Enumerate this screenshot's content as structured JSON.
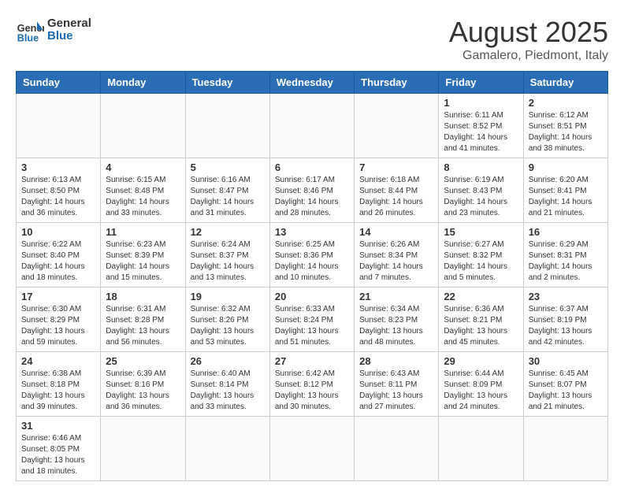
{
  "logo": {
    "text_general": "General",
    "text_blue": "Blue"
  },
  "title": "August 2025",
  "subtitle": "Gamalero, Piedmont, Italy",
  "weekdays": [
    "Sunday",
    "Monday",
    "Tuesday",
    "Wednesday",
    "Thursday",
    "Friday",
    "Saturday"
  ],
  "weeks": [
    [
      {
        "day": "",
        "info": ""
      },
      {
        "day": "",
        "info": ""
      },
      {
        "day": "",
        "info": ""
      },
      {
        "day": "",
        "info": ""
      },
      {
        "day": "",
        "info": ""
      },
      {
        "day": "1",
        "info": "Sunrise: 6:11 AM\nSunset: 8:52 PM\nDaylight: 14 hours and 41 minutes."
      },
      {
        "day": "2",
        "info": "Sunrise: 6:12 AM\nSunset: 8:51 PM\nDaylight: 14 hours and 38 minutes."
      }
    ],
    [
      {
        "day": "3",
        "info": "Sunrise: 6:13 AM\nSunset: 8:50 PM\nDaylight: 14 hours and 36 minutes."
      },
      {
        "day": "4",
        "info": "Sunrise: 6:15 AM\nSunset: 8:48 PM\nDaylight: 14 hours and 33 minutes."
      },
      {
        "day": "5",
        "info": "Sunrise: 6:16 AM\nSunset: 8:47 PM\nDaylight: 14 hours and 31 minutes."
      },
      {
        "day": "6",
        "info": "Sunrise: 6:17 AM\nSunset: 8:46 PM\nDaylight: 14 hours and 28 minutes."
      },
      {
        "day": "7",
        "info": "Sunrise: 6:18 AM\nSunset: 8:44 PM\nDaylight: 14 hours and 26 minutes."
      },
      {
        "day": "8",
        "info": "Sunrise: 6:19 AM\nSunset: 8:43 PM\nDaylight: 14 hours and 23 minutes."
      },
      {
        "day": "9",
        "info": "Sunrise: 6:20 AM\nSunset: 8:41 PM\nDaylight: 14 hours and 21 minutes."
      }
    ],
    [
      {
        "day": "10",
        "info": "Sunrise: 6:22 AM\nSunset: 8:40 PM\nDaylight: 14 hours and 18 minutes."
      },
      {
        "day": "11",
        "info": "Sunrise: 6:23 AM\nSunset: 8:39 PM\nDaylight: 14 hours and 15 minutes."
      },
      {
        "day": "12",
        "info": "Sunrise: 6:24 AM\nSunset: 8:37 PM\nDaylight: 14 hours and 13 minutes."
      },
      {
        "day": "13",
        "info": "Sunrise: 6:25 AM\nSunset: 8:36 PM\nDaylight: 14 hours and 10 minutes."
      },
      {
        "day": "14",
        "info": "Sunrise: 6:26 AM\nSunset: 8:34 PM\nDaylight: 14 hours and 7 minutes."
      },
      {
        "day": "15",
        "info": "Sunrise: 6:27 AM\nSunset: 8:32 PM\nDaylight: 14 hours and 5 minutes."
      },
      {
        "day": "16",
        "info": "Sunrise: 6:29 AM\nSunset: 8:31 PM\nDaylight: 14 hours and 2 minutes."
      }
    ],
    [
      {
        "day": "17",
        "info": "Sunrise: 6:30 AM\nSunset: 8:29 PM\nDaylight: 13 hours and 59 minutes."
      },
      {
        "day": "18",
        "info": "Sunrise: 6:31 AM\nSunset: 8:28 PM\nDaylight: 13 hours and 56 minutes."
      },
      {
        "day": "19",
        "info": "Sunrise: 6:32 AM\nSunset: 8:26 PM\nDaylight: 13 hours and 53 minutes."
      },
      {
        "day": "20",
        "info": "Sunrise: 6:33 AM\nSunset: 8:24 PM\nDaylight: 13 hours and 51 minutes."
      },
      {
        "day": "21",
        "info": "Sunrise: 6:34 AM\nSunset: 8:23 PM\nDaylight: 13 hours and 48 minutes."
      },
      {
        "day": "22",
        "info": "Sunrise: 6:36 AM\nSunset: 8:21 PM\nDaylight: 13 hours and 45 minutes."
      },
      {
        "day": "23",
        "info": "Sunrise: 6:37 AM\nSunset: 8:19 PM\nDaylight: 13 hours and 42 minutes."
      }
    ],
    [
      {
        "day": "24",
        "info": "Sunrise: 6:38 AM\nSunset: 8:18 PM\nDaylight: 13 hours and 39 minutes."
      },
      {
        "day": "25",
        "info": "Sunrise: 6:39 AM\nSunset: 8:16 PM\nDaylight: 13 hours and 36 minutes."
      },
      {
        "day": "26",
        "info": "Sunrise: 6:40 AM\nSunset: 8:14 PM\nDaylight: 13 hours and 33 minutes."
      },
      {
        "day": "27",
        "info": "Sunrise: 6:42 AM\nSunset: 8:12 PM\nDaylight: 13 hours and 30 minutes."
      },
      {
        "day": "28",
        "info": "Sunrise: 6:43 AM\nSunset: 8:11 PM\nDaylight: 13 hours and 27 minutes."
      },
      {
        "day": "29",
        "info": "Sunrise: 6:44 AM\nSunset: 8:09 PM\nDaylight: 13 hours and 24 minutes."
      },
      {
        "day": "30",
        "info": "Sunrise: 6:45 AM\nSunset: 8:07 PM\nDaylight: 13 hours and 21 minutes."
      }
    ],
    [
      {
        "day": "31",
        "info": "Sunrise: 6:46 AM\nSunset: 8:05 PM\nDaylight: 13 hours and 18 minutes."
      },
      {
        "day": "",
        "info": ""
      },
      {
        "day": "",
        "info": ""
      },
      {
        "day": "",
        "info": ""
      },
      {
        "day": "",
        "info": ""
      },
      {
        "day": "",
        "info": ""
      },
      {
        "day": "",
        "info": ""
      }
    ]
  ]
}
